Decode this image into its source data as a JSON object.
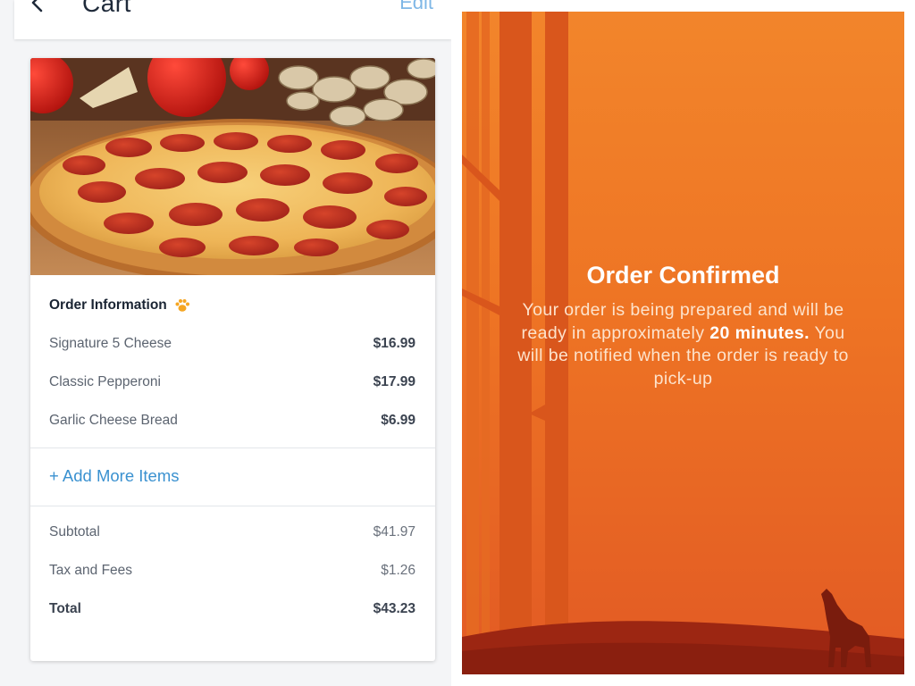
{
  "header": {
    "title": "Cart",
    "edit_label": "Edit"
  },
  "order": {
    "heading": "Order Information",
    "items": [
      {
        "name": "Signature 5 Cheese",
        "price": "$16.99"
      },
      {
        "name": "Classic Pepperoni",
        "price": "$17.99"
      },
      {
        "name": "Garlic Cheese Bread",
        "price": "$6.99"
      }
    ],
    "add_more_label": "+ Add More Items",
    "subtotal_label": "Subtotal",
    "subtotal_value": "$41.97",
    "tax_label": "Tax and Fees",
    "tax_value": "$1.26",
    "total_label": "Total",
    "total_value": "$43.23"
  },
  "confirmation": {
    "title": "Order Confirmed",
    "message_part1": "Your order is being prepared and will be ready in approximately",
    "message_bold": "20 minutes.",
    "message_part2": "You will be notified when the order is ready to pick-up"
  },
  "colors": {
    "accent_blue": "#3a91d0",
    "orange_top": "#f2852b",
    "orange_bottom": "#e25a24",
    "paw_orange": "#f5a623"
  },
  "icons": {
    "back": "back-chevron-icon",
    "paw": "paw-icon",
    "wolf": "howling-wolf-icon"
  }
}
